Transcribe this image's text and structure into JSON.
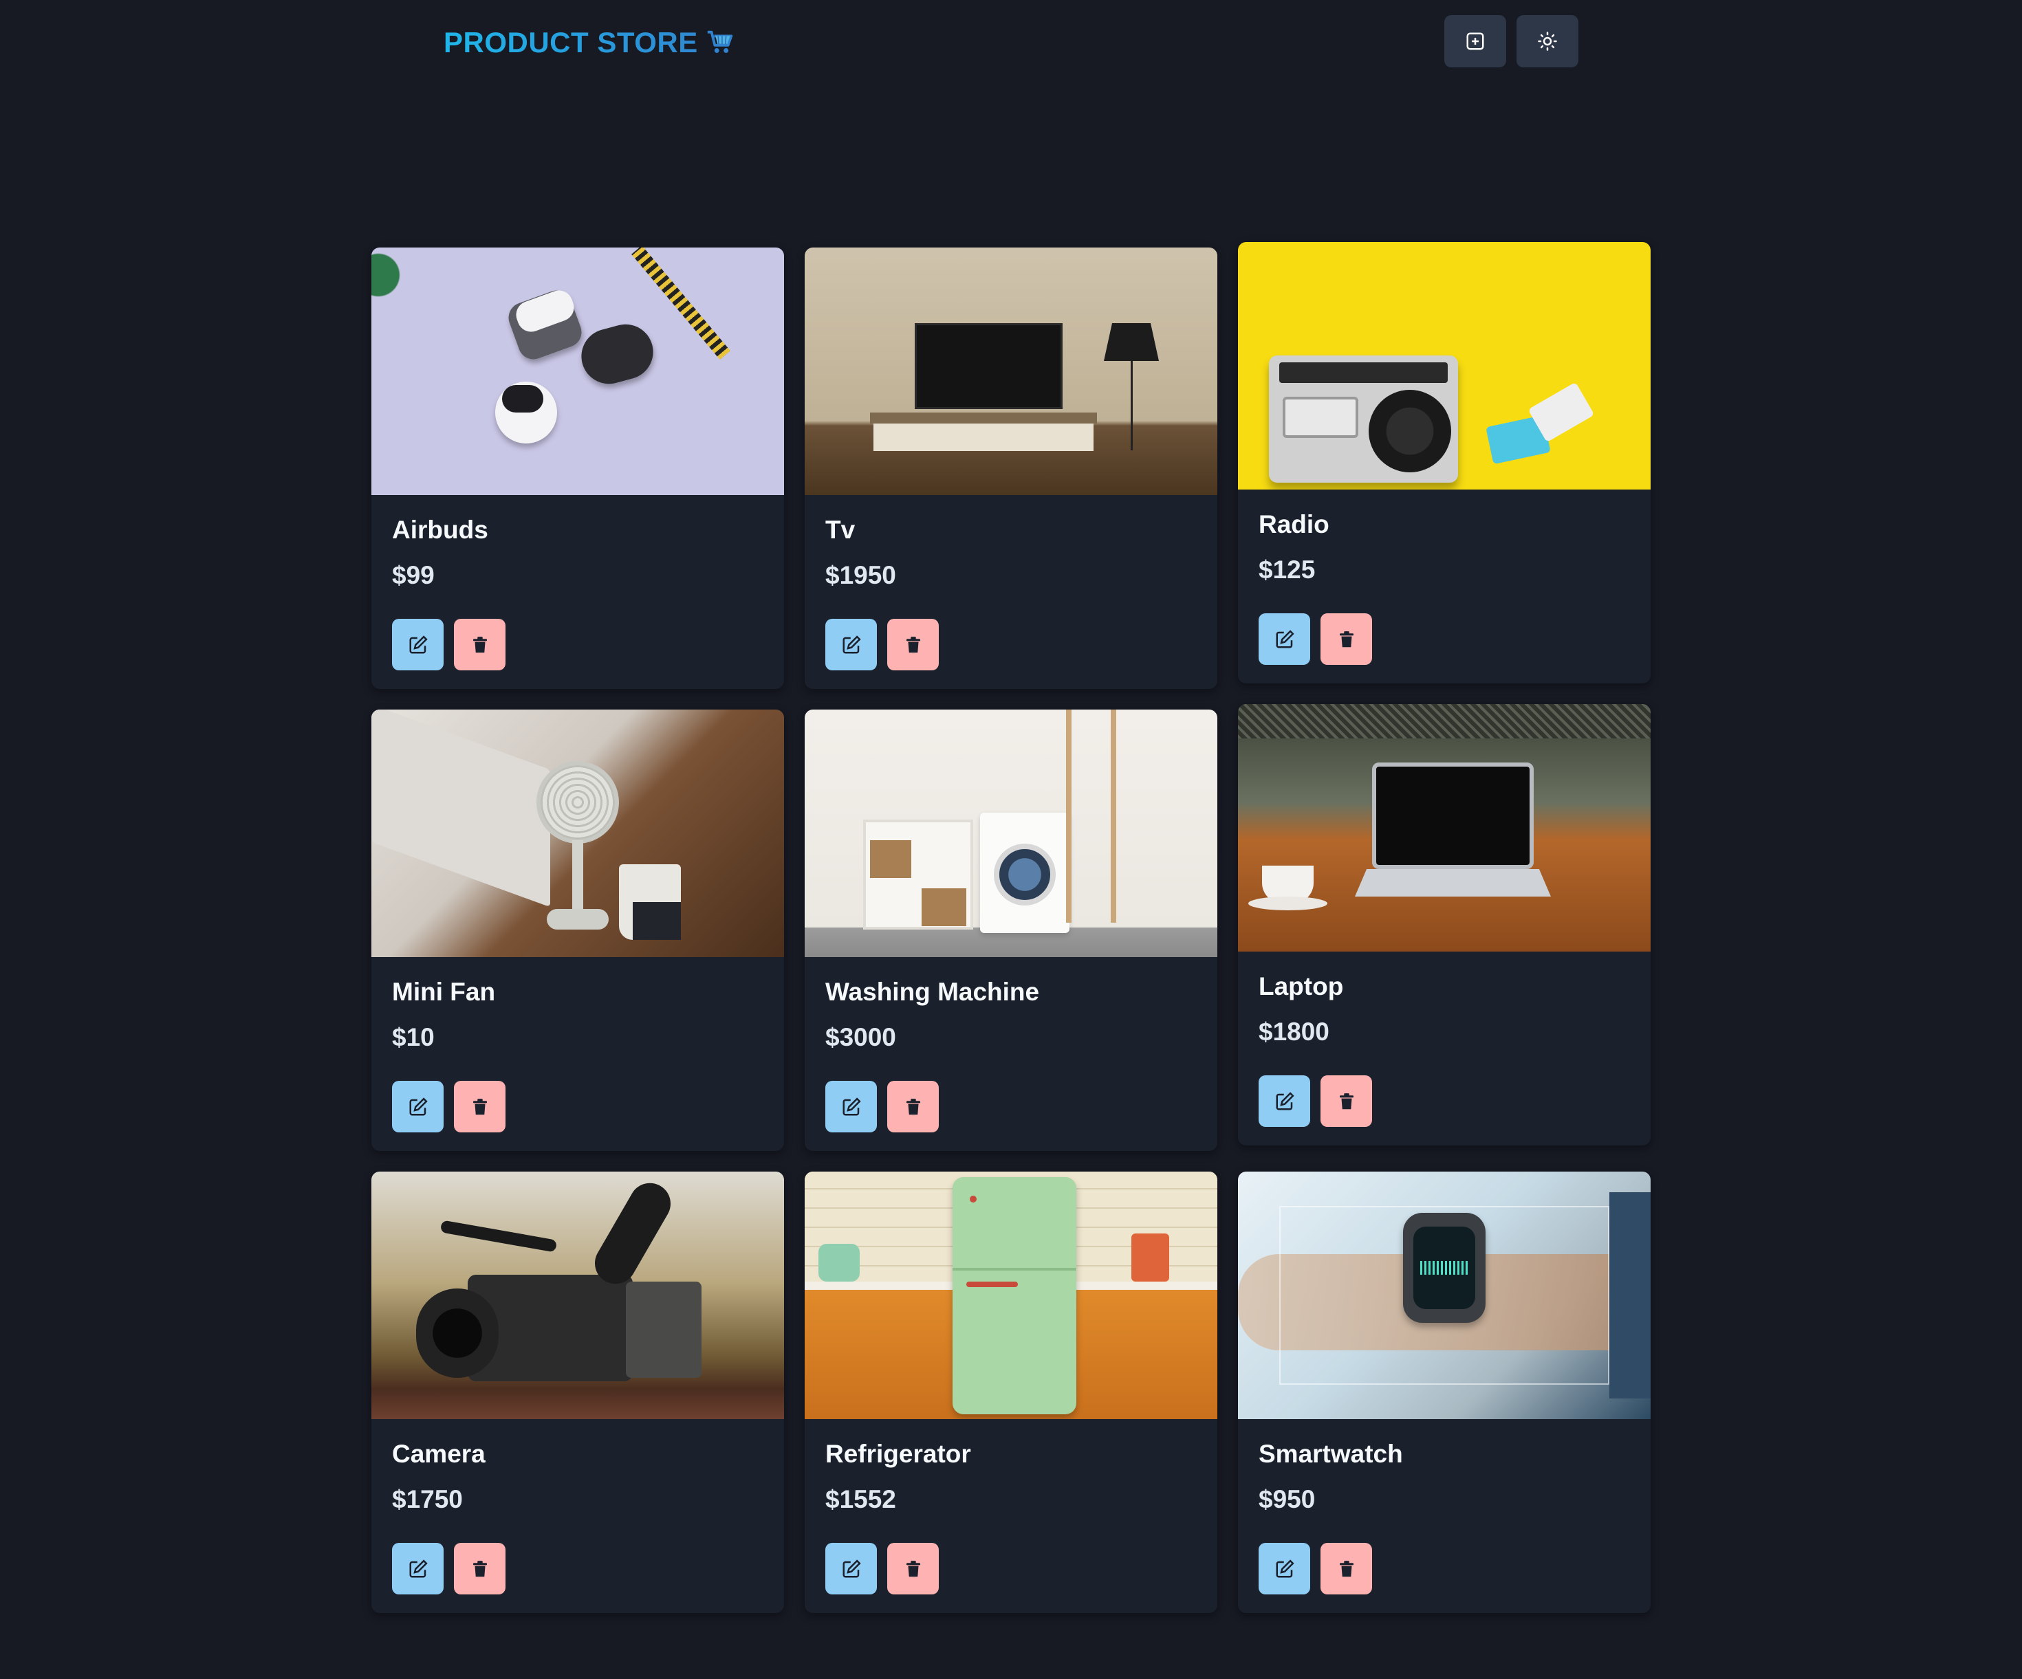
{
  "header": {
    "brand": "PRODUCT STORE",
    "brand_icon": "shopping-cart-icon",
    "buttons": [
      {
        "name": "create-product-button",
        "icon": "plus-square-icon"
      },
      {
        "name": "toggle-theme-button",
        "icon": "sun-icon"
      }
    ]
  },
  "colors": {
    "background": "#171923",
    "card": "#1a202c",
    "brand_gradient_start": "#1fb6ea",
    "brand_gradient_end": "#3182ce",
    "edit_button": "#90cdf4",
    "delete_button": "#feb2b2"
  },
  "products": [
    {
      "name": "Airbuds",
      "price": "$99",
      "image": "earbuds-photo"
    },
    {
      "name": "Tv",
      "price": "$1950",
      "image": "tv-photo"
    },
    {
      "name": "Radio",
      "price": "$125",
      "image": "radio-photo"
    },
    {
      "name": "Mini Fan",
      "price": "$10",
      "image": "mini-fan-photo"
    },
    {
      "name": "Washing Machine",
      "price": "$3000",
      "image": "washing-machine-photo"
    },
    {
      "name": "Laptop",
      "price": "$1800",
      "image": "laptop-photo"
    },
    {
      "name": "Camera",
      "price": "$1750",
      "image": "camera-photo"
    },
    {
      "name": "Refrigerator",
      "price": "$1552",
      "image": "refrigerator-photo"
    },
    {
      "name": "Smartwatch",
      "price": "$950",
      "image": "smartwatch-photo"
    }
  ],
  "card_actions": {
    "edit_icon": "edit-icon",
    "delete_icon": "trash-icon"
  }
}
